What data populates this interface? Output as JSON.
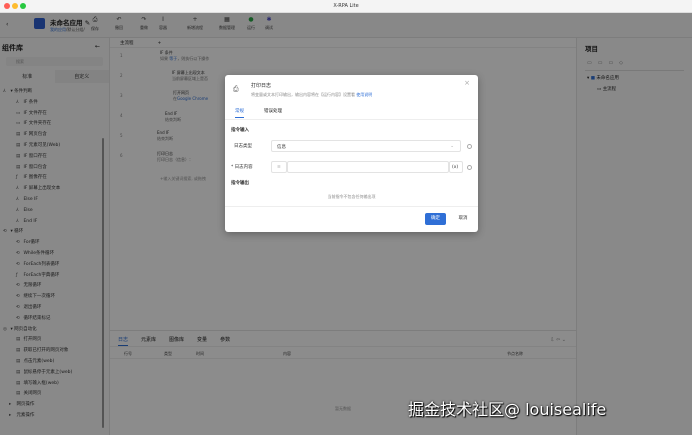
{
  "window": {
    "title": "X-RPA Lite"
  },
  "app": {
    "name": "未命名应用",
    "edit_icon": "✎",
    "crumb_link": "我的应用",
    "crumb_rest": "/默认分组/"
  },
  "toolbar": [
    {
      "label": "保存",
      "icon": "⎙"
    },
    {
      "label": "撤回",
      "icon": "↶"
    },
    {
      "label": "重做",
      "icon": "↷"
    },
    {
      "label": "容器",
      "icon": "Ⅰ"
    },
    {
      "label": "新增流程",
      "icon": "+"
    },
    {
      "label": "数据管理",
      "icon": "▦"
    },
    {
      "label": "运行",
      "icon": "●"
    },
    {
      "label": "调试",
      "icon": "✱"
    }
  ],
  "left": {
    "title": "组件库",
    "collapse": "←",
    "search_placeholder": "搜索",
    "tabs": [
      "标准",
      "自定义"
    ],
    "tree": [
      {
        "t": "g",
        "icon": "⅄",
        "label": "▾ 条件判断"
      },
      {
        "t": "c",
        "icon": "⅄",
        "label": "IF 条件"
      },
      {
        "t": "c",
        "icon": "▭",
        "label": "IF 文件存在"
      },
      {
        "t": "c",
        "icon": "▭",
        "label": "IF 文件夹存在"
      },
      {
        "t": "c",
        "icon": "▤",
        "label": "IF 网页包含"
      },
      {
        "t": "c",
        "icon": "▤",
        "label": "IF 元素可见(Web)"
      },
      {
        "t": "c",
        "icon": "▤",
        "label": "IF 窗口存在"
      },
      {
        "t": "c",
        "icon": "▤",
        "label": "IF 窗口包含"
      },
      {
        "t": "c",
        "icon": "ƒ",
        "label": "IF 图像存在"
      },
      {
        "t": "c",
        "icon": "⅄",
        "label": "IF 屏幕上出现文本"
      },
      {
        "t": "c",
        "icon": "⅄",
        "label": "Else IF"
      },
      {
        "t": "c",
        "icon": "⅄",
        "label": "Else"
      },
      {
        "t": "c",
        "icon": "⅄",
        "label": "End IF"
      },
      {
        "t": "g",
        "icon": "⟲",
        "label": "▾ 循环"
      },
      {
        "t": "c",
        "icon": "⟲",
        "label": "For循环"
      },
      {
        "t": "c",
        "icon": "⟲",
        "label": "While条件循环"
      },
      {
        "t": "c",
        "icon": "⟲",
        "label": "ForEach列表循环"
      },
      {
        "t": "c",
        "icon": "ƒ",
        "label": "ForEach字典循环"
      },
      {
        "t": "c",
        "icon": "⟲",
        "label": "无限循环"
      },
      {
        "t": "c",
        "icon": "⟲",
        "label": "继续下一次循环"
      },
      {
        "t": "c",
        "icon": "⟲",
        "label": "退出循环"
      },
      {
        "t": "c",
        "icon": "⟲",
        "label": "循环结束标记"
      },
      {
        "t": "g",
        "icon": "◎",
        "label": "▾ 网页自动化"
      },
      {
        "t": "c",
        "icon": "▤",
        "label": "打开网页"
      },
      {
        "t": "c",
        "icon": "▤",
        "label": "获取已打开的网页对象"
      },
      {
        "t": "c",
        "icon": "▤",
        "label": "点击元素(web)"
      },
      {
        "t": "c",
        "icon": "▤",
        "label": "鼠标悬停于元素上(web)"
      },
      {
        "t": "c",
        "icon": "▤",
        "label": "填写输入框(web)"
      },
      {
        "t": "c",
        "icon": "▤",
        "label": "关闭网页"
      },
      {
        "t": "s",
        "icon": "▸",
        "label": "网页操作"
      },
      {
        "t": "s",
        "icon": "▸",
        "label": "元素操作"
      }
    ]
  },
  "canvas": {
    "tab": "主流程",
    "add": "+",
    "lines": [
      "1",
      "2",
      "3",
      "4",
      "5",
      "6"
    ],
    "nodes": [
      {
        "title": "IF 条件",
        "pre": "如果 ",
        "link": "等于",
        "post": "，则执行以下操作"
      },
      {
        "title": "IF 屏幕上出现文本",
        "pre": "当前屏幕区域上是否",
        "link": "",
        "post": ""
      },
      {
        "title": "打开网页",
        "pre": "在",
        "link": "Google Chrome",
        "post": ""
      },
      {
        "title": "End IF",
        "pre": "结束判断",
        "link": "",
        "post": ""
      },
      {
        "title": "End IF",
        "pre": "结束判断",
        "link": "",
        "post": ""
      },
      {
        "title": "打印日志",
        "pre": "打印日志（信息）：",
        "link": "",
        "post": ""
      }
    ],
    "hint": "+输入关键词搜索, 或拖拽"
  },
  "right": {
    "title": "项目",
    "project": "未命名应用",
    "flow": "主流程"
  },
  "bottom": {
    "tabs": [
      "日志",
      "元素库",
      "图像库",
      "变量",
      "参数"
    ],
    "columns": [
      "行号",
      "类型",
      "时间",
      "内容",
      "节点名称"
    ],
    "empty": "暂无数据"
  },
  "modal": {
    "title": "打印日志",
    "desc": "将变量或文本打印输出，输出内容将在【运行内容】设置看",
    "help_link": "使用说明",
    "close": "×",
    "tabs": [
      "常规",
      "错误处理"
    ],
    "input_section": "指令输入",
    "log_type_label": "日志类型",
    "log_type_value": "信息",
    "log_content_label": "* 日志内容",
    "log_content_value": "",
    "expr_btn": "(x)",
    "prefix": "≡",
    "output_section": "指令输出",
    "no_output": "当前指令不包含任何输出项",
    "ok": "确定",
    "cancel": "取消"
  },
  "watermark": "掘金技术社区@ louisealife"
}
